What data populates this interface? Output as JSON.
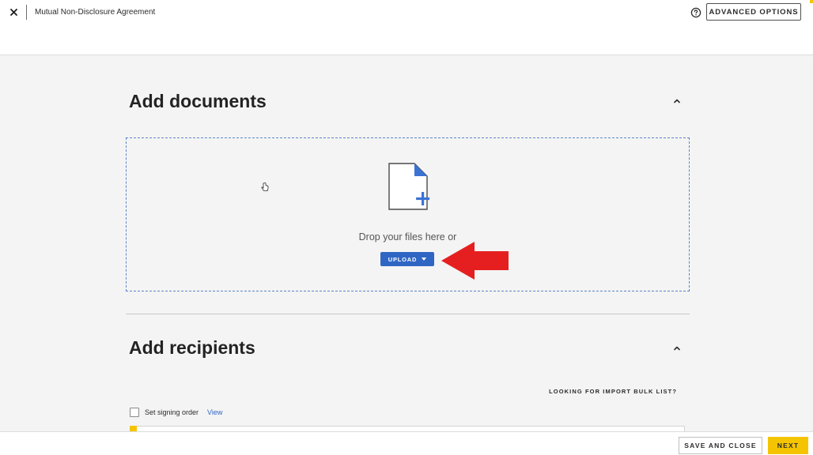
{
  "header": {
    "document_title": "Mutual Non-Disclosure Agreement",
    "advanced_options_label": "ADVANCED OPTIONS"
  },
  "add_documents": {
    "title": "Add documents",
    "drop_text": "Drop your files here or",
    "upload_label": "UPLOAD"
  },
  "add_recipients": {
    "title": "Add recipients",
    "bulk_list_link": "LOOKING FOR IMPORT BULK LIST?",
    "signing_order_label": "Set signing order",
    "signing_order_checked": false,
    "view_link": "View"
  },
  "footer": {
    "save_close_label": "SAVE AND CLOSE",
    "next_label": "NEXT"
  },
  "colors": {
    "accent_blue": "#2f66c4",
    "accent_yellow": "#f5c400",
    "arrow_red": "#e51f1f"
  },
  "icons": {
    "close": "close-icon",
    "help": "help-icon",
    "collapse": "chevron-up-icon",
    "file_add": "file-add-icon",
    "arrow": "red-arrow-icon",
    "cursor": "hand-cursor-icon"
  }
}
